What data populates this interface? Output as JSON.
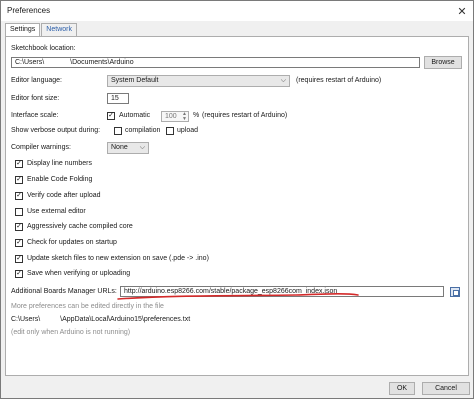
{
  "window": {
    "title": "Preferences",
    "close_glyph": "✕"
  },
  "tabs": [
    {
      "label": "Settings",
      "active": true
    },
    {
      "label": "Network",
      "active": false
    }
  ],
  "sketchbook": {
    "label": "Sketchbook location:",
    "path_prefix": "C:\\Users\\",
    "path_suffix": "\\Documents\\Arduino",
    "browse_label": "Browse"
  },
  "editor_language": {
    "label": "Editor language:",
    "value": "System Default",
    "note": "(requires restart of Arduino)"
  },
  "font_size": {
    "label": "Editor font size:",
    "value": "15"
  },
  "interface_scale": {
    "label": "Interface scale:",
    "automatic_label": "Automatic",
    "automatic_checked": true,
    "value": "100",
    "unit": "%",
    "note": "(requires restart of Arduino)"
  },
  "verbose": {
    "label": "Show verbose output during:",
    "compilation_label": "compilation",
    "compilation_checked": false,
    "upload_label": "upload",
    "upload_checked": false
  },
  "compiler_warnings": {
    "label": "Compiler warnings:",
    "value": "None"
  },
  "checkboxes": [
    {
      "label": "Display line numbers",
      "checked": true
    },
    {
      "label": "Enable Code Folding",
      "checked": true
    },
    {
      "label": "Verify code after upload",
      "checked": true
    },
    {
      "label": "Use external editor",
      "checked": false
    },
    {
      "label": "Aggressively cache compiled core",
      "checked": true
    },
    {
      "label": "Check for updates on startup",
      "checked": true
    },
    {
      "label": "Update sketch files to new extension on save (.pde -> .ino)",
      "checked": true
    },
    {
      "label": "Save when verifying or uploading",
      "checked": true
    }
  ],
  "boards_manager": {
    "label": "Additional Boards Manager URLs:",
    "value": "http://arduino.esp8266.com/stable/package_esp8266com_index.json"
  },
  "footer": {
    "more_prefs": "More preferences can be edited directly in the file",
    "prefs_path_prefix": "C:\\Users\\",
    "prefs_path_suffix": "\\AppData\\Local\\Arduino15\\preferences.txt",
    "edit_note": "(edit only when Arduino is not running)"
  },
  "buttons": {
    "ok": "OK",
    "cancel": "Cancel"
  },
  "colors": {
    "annotation_red": "#d42a2a",
    "tab_link": "#2a5da8"
  }
}
